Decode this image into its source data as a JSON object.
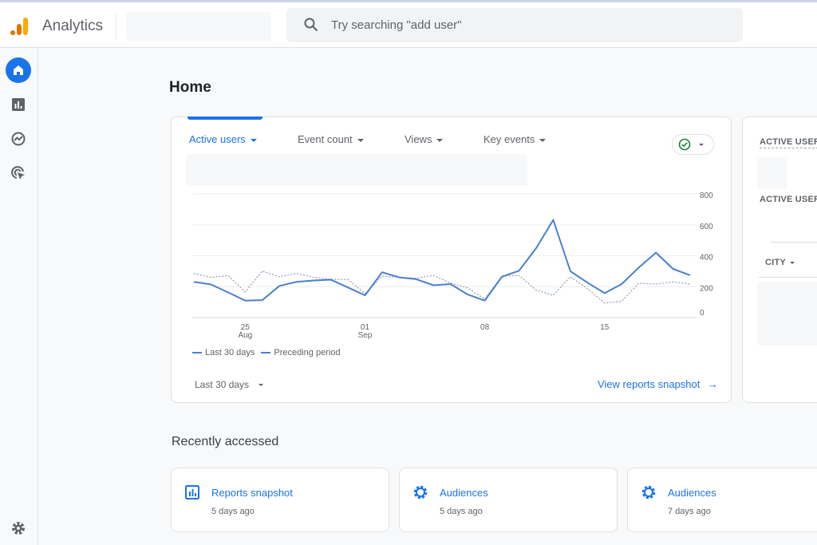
{
  "header": {
    "app_title": "Analytics",
    "search_placeholder": "Try searching \"add user\""
  },
  "sidebar": {
    "items": [
      {
        "icon": "home-icon",
        "active": true
      },
      {
        "icon": "reports-icon"
      },
      {
        "icon": "explore-icon"
      },
      {
        "icon": "advertising-icon"
      }
    ],
    "settings_icon": "gear-icon"
  },
  "page_title": "Home",
  "main_card": {
    "metrics": [
      "Active users",
      "Event count",
      "Views",
      "Key events"
    ],
    "date_range": "Last 30 days",
    "view_snapshot": "View reports snapshot",
    "status_icon": "check-circle-icon"
  },
  "chart_data": {
    "type": "line",
    "x": [
      "Aug 22",
      "Aug 23",
      "Aug 24",
      "Aug 25",
      "Aug 26",
      "Aug 27",
      "Aug 28",
      "Aug 29",
      "Aug 30",
      "Aug 31",
      "Sep 01",
      "Sep 02",
      "Sep 03",
      "Sep 04",
      "Sep 05",
      "Sep 06",
      "Sep 07",
      "Sep 08",
      "Sep 09",
      "Sep 10",
      "Sep 11",
      "Sep 12",
      "Sep 13",
      "Sep 14",
      "Sep 15",
      "Sep 16",
      "Sep 17",
      "Sep 18",
      "Sep 19",
      "Sep 20"
    ],
    "x_ticks": [
      {
        "index": 3,
        "label": "25",
        "sub": "Aug"
      },
      {
        "index": 10,
        "label": "01",
        "sub": "Sep"
      },
      {
        "index": 17,
        "label": "08",
        "sub": ""
      },
      {
        "index": 24,
        "label": "15",
        "sub": ""
      }
    ],
    "y_ticks": [
      "800",
      "600",
      "400",
      "200",
      "0"
    ],
    "ylim": [
      0,
      800
    ],
    "grid": true,
    "legend_position": "bottom-left",
    "series": [
      {
        "name": "Last 30 days",
        "style": "solid",
        "color": "#4a7fd0",
        "values": [
          231,
          214,
          163,
          110,
          113,
          205,
          231,
          240,
          245,
          195,
          144,
          293,
          260,
          248,
          209,
          217,
          149,
          110,
          264,
          303,
          449,
          632,
          300,
          226,
          158,
          217,
          324,
          420,
          315,
          274
        ]
      },
      {
        "name": "Preceding period",
        "style": "dotted",
        "color": "#8a9bb5",
        "values": [
          286,
          260,
          272,
          166,
          301,
          264,
          286,
          260,
          247,
          247,
          154,
          269,
          260,
          255,
          272,
          223,
          192,
          120,
          269,
          272,
          178,
          144,
          264,
          188,
          94,
          106,
          223,
          217,
          231,
          217
        ]
      }
    ]
  },
  "side_card": {
    "label1": "ACTIVE USERS",
    "label2": "ACTIVE USERS",
    "column": "CITY"
  },
  "recent": {
    "title": "Recently accessed",
    "items": [
      {
        "title": "Reports snapshot",
        "subtitle": "5 days ago",
        "icon": "reports-icon"
      },
      {
        "title": "Audiences",
        "subtitle": "5 days ago",
        "icon": "gear-icon"
      },
      {
        "title": "Audiences",
        "subtitle": "7 days ago",
        "icon": "gear-icon"
      }
    ]
  }
}
